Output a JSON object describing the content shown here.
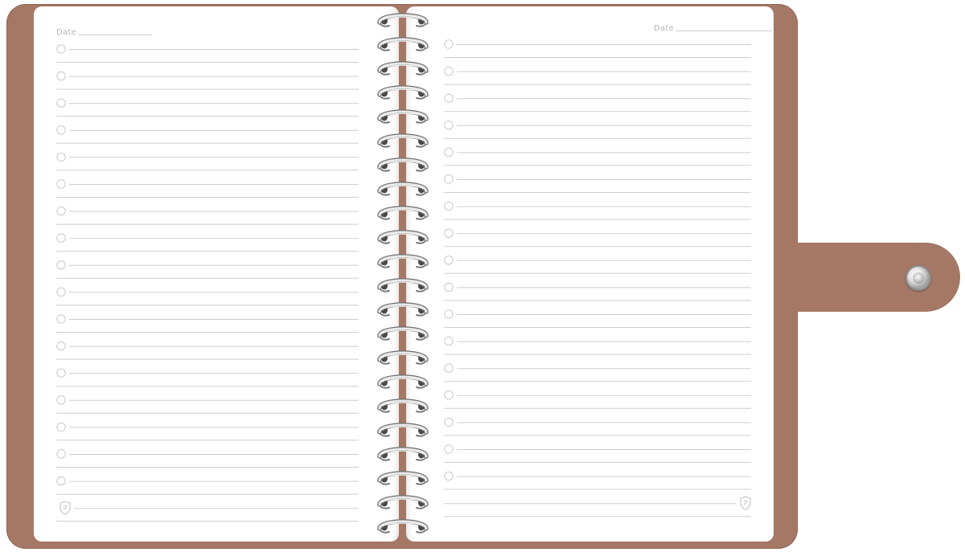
{
  "notebook": {
    "cover_color": "#a57866",
    "cover_shadow": "#8f6555",
    "page_color": "#ffffff",
    "rule_color": "#cdcdcd",
    "circle_color": "#c9c9c9",
    "left_page": {
      "date_label": "Date",
      "entry_count": 17,
      "footer_icon": "shield-logo-icon"
    },
    "right_page": {
      "date_label": "Date",
      "entry_count": 17,
      "footer_icon": "shield-logo-icon"
    },
    "binding": {
      "type": "spiral",
      "ring_count": 22,
      "icon": "spiral-ring-icon"
    },
    "closure": {
      "icon": "snap-button-icon"
    }
  }
}
